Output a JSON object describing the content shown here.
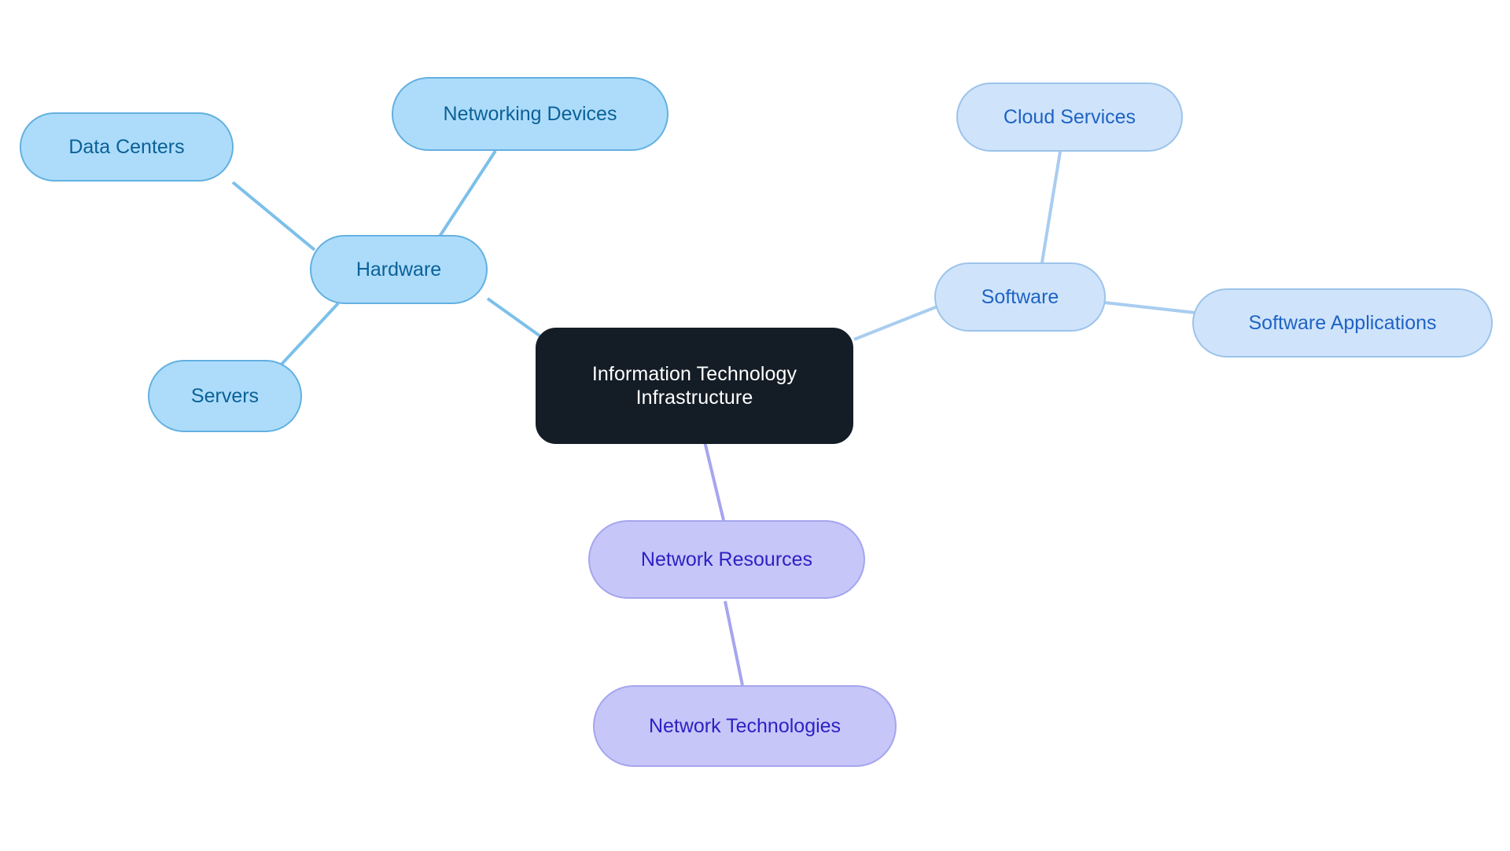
{
  "diagram": {
    "type": "mindmap",
    "title": "Information Technology Infrastructure",
    "background_color": "#ffffff",
    "root": {
      "id": "root",
      "label": "Information Technology\nInfrastructure",
      "fill": "#141c26",
      "text_color": "#ffffff"
    },
    "branches": [
      {
        "id": "hardware",
        "label": "Hardware",
        "fill": "#addcfb",
        "border": "#62b0e0",
        "text_color": "#0b6196",
        "edge_color": "#7cc0ea",
        "children": [
          {
            "id": "data-centers",
            "label": "Data Centers"
          },
          {
            "id": "networking-devices",
            "label": "Networking Devices"
          },
          {
            "id": "servers",
            "label": "Servers"
          }
        ]
      },
      {
        "id": "software",
        "label": "Software",
        "fill": "#cfe4fb",
        "border": "#9cc3ea",
        "text_color": "#1f63c4",
        "edge_color": "#a8cdf0",
        "children": [
          {
            "id": "cloud-services",
            "label": "Cloud Services"
          },
          {
            "id": "software-applications",
            "label": "Software Applications"
          }
        ]
      },
      {
        "id": "network-resources",
        "label": "Network Resources",
        "fill": "#c6c6f8",
        "border": "#a5a5ef",
        "text_color": "#2d21c4",
        "edge_color": "#a5a5ef",
        "children": [
          {
            "id": "network-technologies",
            "label": "Network Technologies"
          }
        ]
      }
    ]
  },
  "nodes": {
    "root": "Information Technology\nInfrastructure",
    "hardware": "Hardware",
    "data_centers": "Data Centers",
    "networking_devices": "Networking Devices",
    "servers": "Servers",
    "software": "Software",
    "cloud_services": "Cloud Services",
    "software_applications": "Software Applications",
    "network_resources": "Network Resources",
    "network_technologies": "Network Technologies"
  }
}
